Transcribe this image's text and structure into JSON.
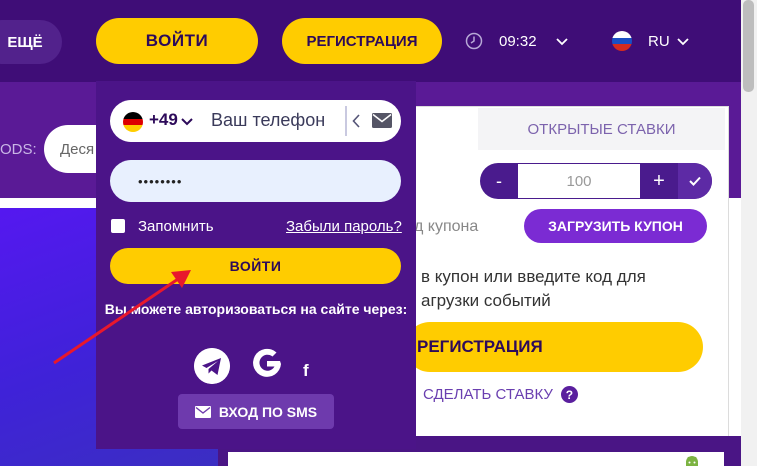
{
  "header": {
    "more_label": "ЕЩЁ",
    "login_label": "ВОЙТИ",
    "register_label": "РЕГИСТРАЦИЯ",
    "time": "09:32",
    "language": "RU"
  },
  "odds": {
    "label": "ODS:",
    "value": "Деся"
  },
  "betslip": {
    "tab_open_bets": "ОТКРЫТЫЕ СТАВКИ",
    "stake_minus": "-",
    "stake_value": "100",
    "stake_plus": "+",
    "coupon_code_placeholder": "д купона",
    "load_coupon_label": "ЗАГРУЗИТЬ КУПОН",
    "hint_line1": "в купон или введите код для",
    "hint_line2": "агрузки событий",
    "register_label": "РЕГИСТРАЦИЯ",
    "how_to_bet": "СДЕЛАТЬ СТАВКУ",
    "help_glyph": "?"
  },
  "login_popup": {
    "country_code": "+49",
    "phone_placeholder": "Ваш телефон",
    "password_value": "••••••••",
    "remember_label": "Запомнить",
    "forgot_password": "Забыли пароль?",
    "submit_label": "ВОЙТИ",
    "social_text": "Вы можете авторизоваться на сайте через:",
    "facebook_glyph": "f",
    "sms_login_label": "ВХОД ПО SMS"
  },
  "icons": {
    "clock": "clock-icon",
    "language_flag": "russia-flag-icon",
    "country_flag": "germany-flag-icon",
    "mail": "mail-icon",
    "telegram": "telegram-icon",
    "google": "google-icon",
    "facebook": "facebook-icon",
    "android": "android-icon"
  },
  "colors": {
    "brand_purple": "#3f0d77",
    "popup_purple": "#4b1488",
    "accent_yellow": "#ffcc00",
    "load_coupon_purple": "#7b2bd3",
    "annotation_arrow": "#e8182c"
  }
}
